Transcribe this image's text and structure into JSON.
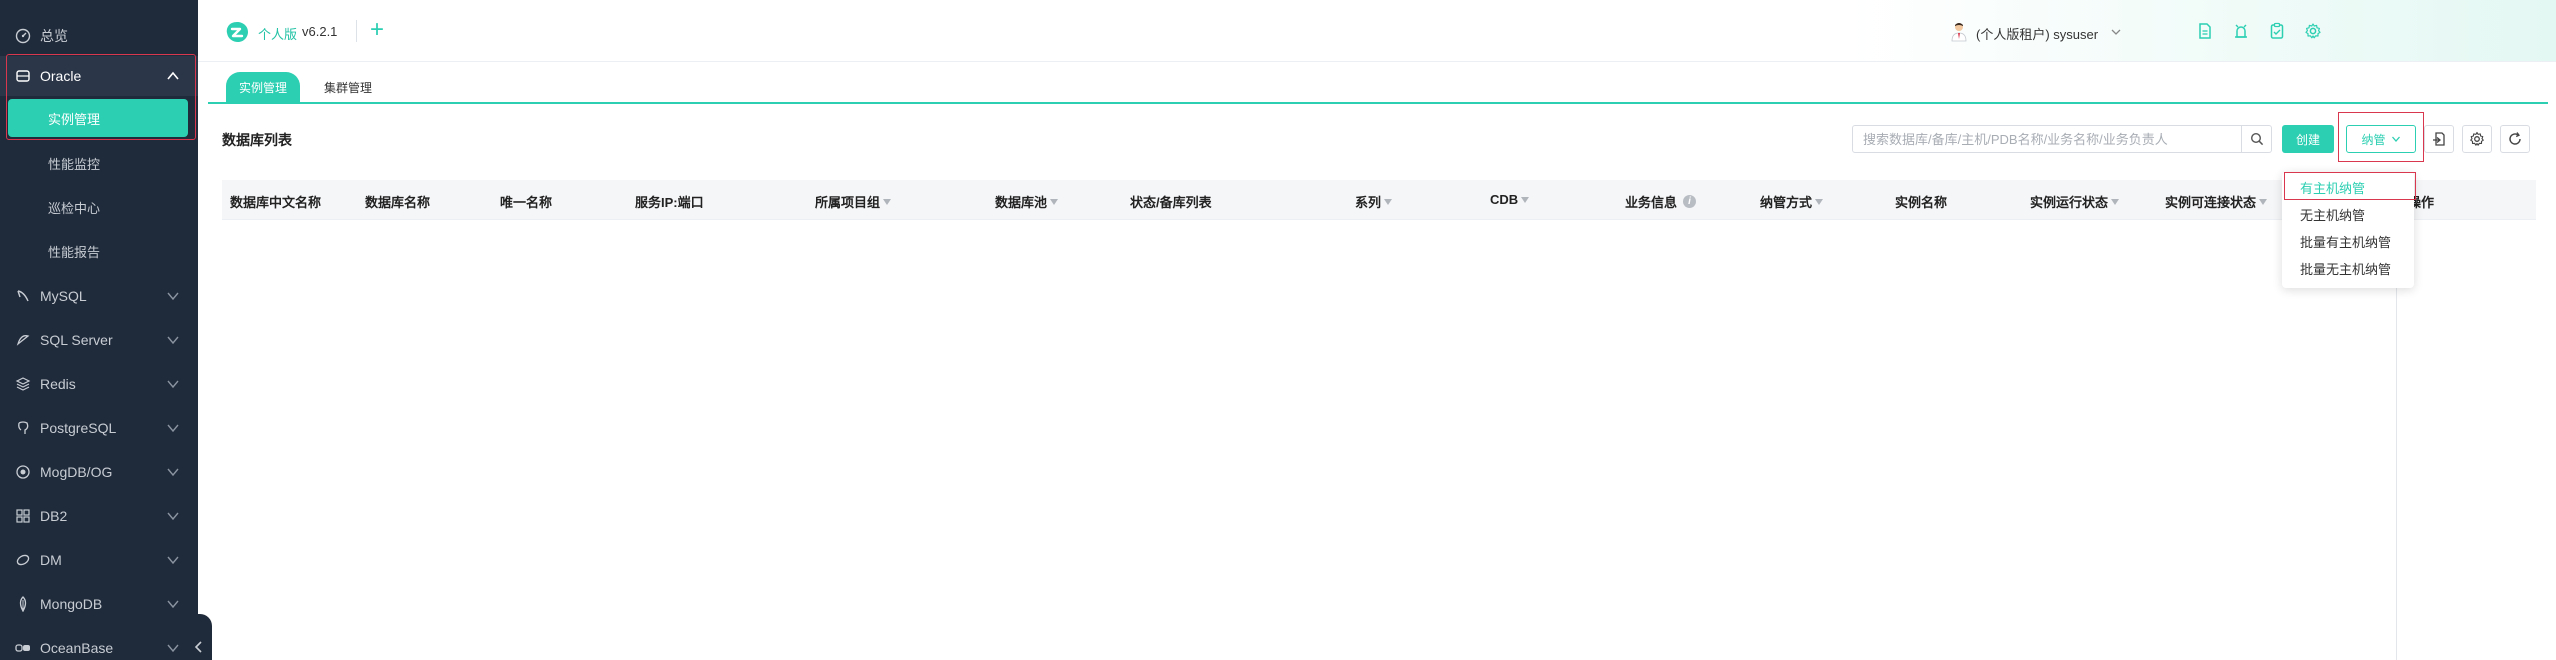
{
  "sidebar": {
    "overview": "总览",
    "oracle": "Oracle",
    "oracle_subs": [
      "实例管理",
      "性能监控",
      "巡检中心",
      "性能报告"
    ],
    "groups": [
      "MySQL",
      "SQL Server",
      "Redis",
      "PostgreSQL",
      "MogDB/OG",
      "DB2",
      "DM",
      "MongoDB",
      "OceanBase"
    ]
  },
  "header": {
    "brand": "个人版",
    "version": "v6.2.1",
    "plus": "+",
    "user": "(个人版租户) sysuser"
  },
  "tabs": [
    "实例管理",
    "集群管理"
  ],
  "list": {
    "title": "数据库列表",
    "search_placeholder": "搜索数据库/备库/主机/PDB名称/业务名称/业务负责人",
    "create_label": "创建",
    "manage_label": "纳管"
  },
  "table": {
    "columns": [
      "数据库中文名称",
      "数据库名称",
      "唯一名称",
      "服务IP:端口",
      "所属项目组",
      "数据库池",
      "状态/备库列表",
      "系列",
      "CDB",
      "业务信息",
      "纳管方式",
      "实例名称",
      "实例运行状态",
      "实例可连接状态",
      "操作"
    ]
  },
  "dropdown": {
    "items": [
      "有主机纳管",
      "无主机纳管",
      "批量有主机纳管",
      "批量无主机纳管"
    ]
  },
  "colors": {
    "accent": "#2ccfb2",
    "sidebar_bg": "#1f2a3a",
    "highlight": "#d8374d"
  }
}
